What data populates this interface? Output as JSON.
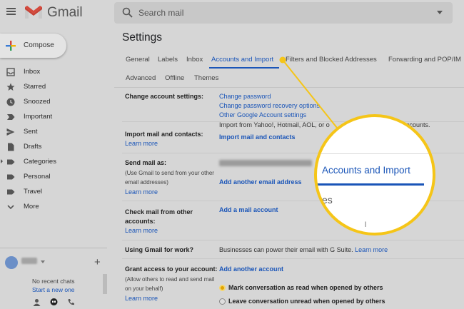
{
  "app": {
    "brand": "Gmail"
  },
  "search": {
    "placeholder": "Search mail"
  },
  "compose": {
    "label": "Compose"
  },
  "sidebar": {
    "items": [
      {
        "label": "Inbox",
        "icon": "inbox-icon"
      },
      {
        "label": "Starred",
        "icon": "star-icon"
      },
      {
        "label": "Snoozed",
        "icon": "clock-icon"
      },
      {
        "label": "Important",
        "icon": "important-icon"
      },
      {
        "label": "Sent",
        "icon": "send-icon"
      },
      {
        "label": "Drafts",
        "icon": "draft-icon"
      },
      {
        "label": "Categories",
        "icon": "label-icon"
      },
      {
        "label": "Personal",
        "icon": "label-icon"
      },
      {
        "label": "Travel",
        "icon": "label-icon"
      },
      {
        "label": "More",
        "icon": "chevron-down-icon"
      }
    ]
  },
  "chat": {
    "empty": "No recent chats",
    "start": "Start a new one"
  },
  "page": {
    "title": "Settings"
  },
  "tabs": {
    "row1": [
      "General",
      "Labels",
      "Inbox",
      "Accounts and Import",
      "Filters and Blocked Addresses",
      "Forwarding and POP/IM"
    ],
    "row2": [
      "Advanced",
      "Offline",
      "Themes"
    ]
  },
  "settings": {
    "change_account": {
      "label": "Change account settings:",
      "links": [
        "Change password",
        "Change password recovery options",
        "Other Google Account settings"
      ],
      "note": "Import from Yahoo!, Hotmail, AOL, or o",
      "note_end": "accounts."
    },
    "import_mail": {
      "label": "Import mail and contacts:",
      "learn_more": "Learn more",
      "action": "Import mail and contacts"
    },
    "send_as": {
      "label": "Send mail as:",
      "sub1": "(Use Gmail to send from your other",
      "sub2": "email addresses)",
      "learn_more": "Learn more",
      "action": "Add another email address"
    },
    "check_mail": {
      "label1": "Check mail from other",
      "label2": "accounts:",
      "learn_more": "Learn more",
      "action": "Add a mail account"
    },
    "work": {
      "label": "Using Gmail for work?",
      "text": "Businesses can power their email with G Suite.",
      "link": "Learn more"
    },
    "grant": {
      "label": "Grant access to your account:",
      "sub1": "(Allow others to read and send mail",
      "sub2": "on your behalf)",
      "learn_more": "Learn more",
      "action": "Add another account",
      "options": [
        "Mark conversation as read when opened by others",
        "Leave conversation unread when opened by others"
      ],
      "selected": 0
    }
  },
  "zoom": {
    "text": "Accounts and Import",
    "lower": "es",
    "tick": "l"
  },
  "colors": {
    "accent": "#1a55b8",
    "callout": "#f5c518"
  }
}
